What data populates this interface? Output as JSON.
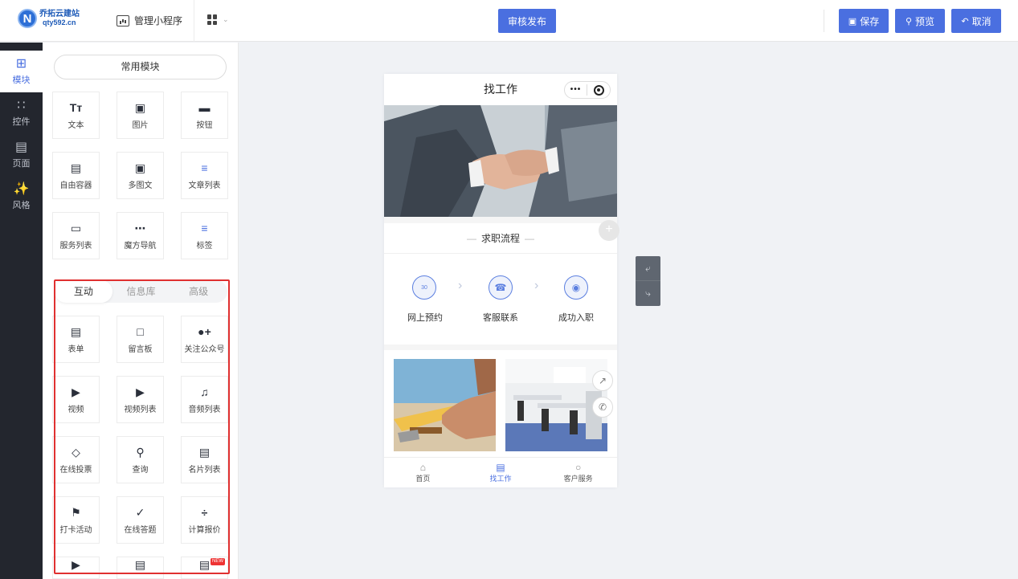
{
  "header": {
    "logo_mark": "N",
    "logo_line1": "乔拓云建站",
    "logo_line2": "qty592.cn",
    "manage_label": "管理小程序",
    "publish_label": "审核发布",
    "save_label": "保存",
    "preview_label": "预览",
    "cancel_label": "取消"
  },
  "rail": {
    "items": [
      {
        "label": "模块",
        "icon": "plus-square-icon"
      },
      {
        "label": "控件",
        "icon": "sliders-icon"
      },
      {
        "label": "页面",
        "icon": "pages-icon"
      },
      {
        "label": "风格",
        "icon": "magic-wand-icon"
      }
    ]
  },
  "panel": {
    "common_title": "常用模块",
    "common_items": [
      {
        "label": "文本",
        "icon": "text-icon"
      },
      {
        "label": "图片",
        "icon": "image-icon"
      },
      {
        "label": "按钮",
        "icon": "button-icon"
      },
      {
        "label": "自由容器",
        "icon": "container-icon"
      },
      {
        "label": "多图文",
        "icon": "multi-image-icon"
      },
      {
        "label": "文章列表",
        "icon": "article-list-icon"
      },
      {
        "label": "服务列表",
        "icon": "service-list-icon"
      },
      {
        "label": "魔方导航",
        "icon": "grid-nav-icon"
      },
      {
        "label": "标签",
        "icon": "tag-icon"
      }
    ],
    "tabs": [
      "互动",
      "信息库",
      "高级"
    ],
    "active_tab": "互动",
    "interactive_items": [
      {
        "label": "表单",
        "icon": "form-icon"
      },
      {
        "label": "留言板",
        "icon": "message-board-icon"
      },
      {
        "label": "关注公众号",
        "icon": "follow-account-icon"
      },
      {
        "label": "视频",
        "icon": "video-icon"
      },
      {
        "label": "视频列表",
        "icon": "video-list-icon"
      },
      {
        "label": "音频列表",
        "icon": "audio-list-icon"
      },
      {
        "label": "在线投票",
        "icon": "vote-icon"
      },
      {
        "label": "查询",
        "icon": "query-icon"
      },
      {
        "label": "名片列表",
        "icon": "card-list-icon"
      },
      {
        "label": "打卡活动",
        "icon": "check-in-icon"
      },
      {
        "label": "在线答题",
        "icon": "quiz-icon"
      },
      {
        "label": "计算报价",
        "icon": "calculator-icon"
      }
    ],
    "new_badge": "NEW"
  },
  "phone": {
    "title": "找工作",
    "capsule_dots": "•••",
    "section_title": "求职流程",
    "steps": [
      "网上预约",
      "客服联系",
      "成功入职"
    ],
    "step_day": "30",
    "tabbar": [
      {
        "label": "首页",
        "icon": "home-icon"
      },
      {
        "label": "找工作",
        "icon": "document-icon"
      },
      {
        "label": "客户服务",
        "icon": "user-icon"
      }
    ],
    "active_tab": "找工作"
  },
  "colors": {
    "accent": "#4a6fe0",
    "rail_bg": "#23262e",
    "highlight_border": "#e03030"
  }
}
